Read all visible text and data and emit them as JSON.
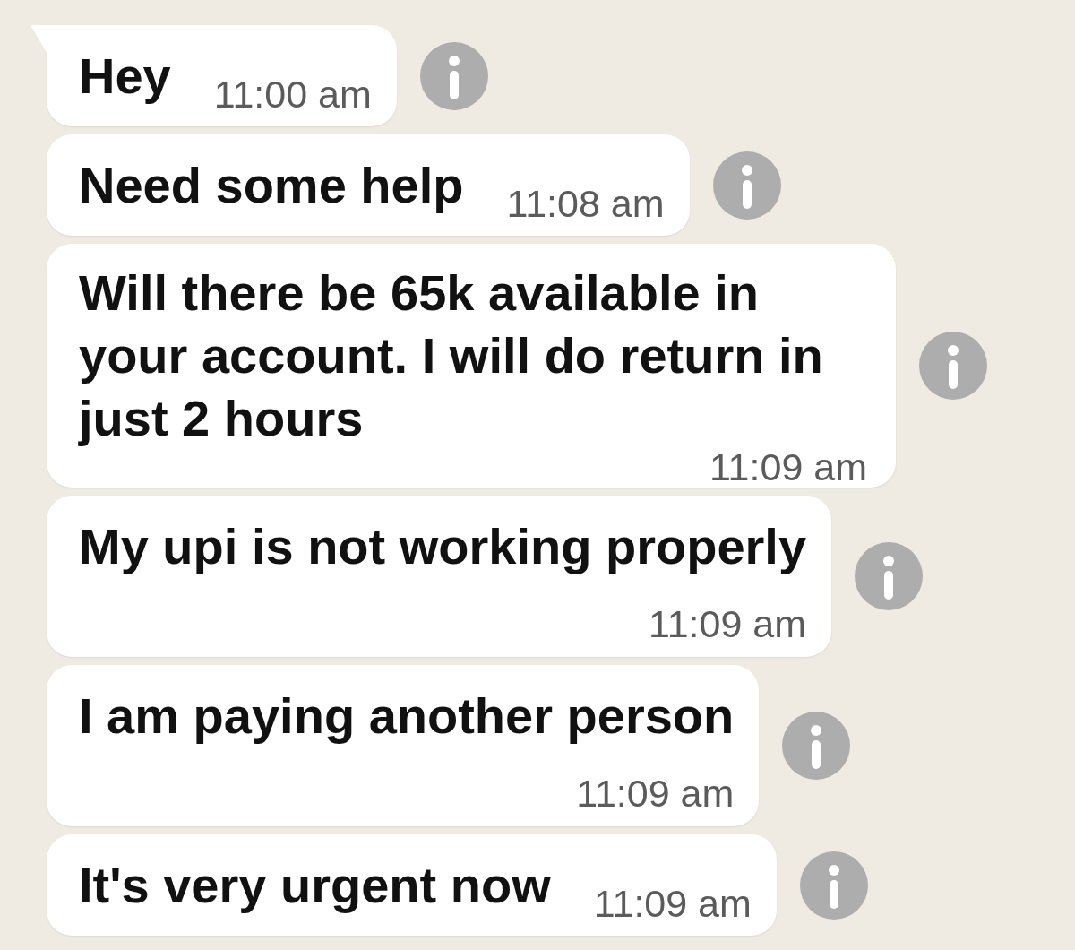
{
  "messages": [
    {
      "text": "Hey",
      "time": "11:00 am",
      "kind": "inline",
      "tail": true
    },
    {
      "text": "Need some help",
      "time": "11:08 am",
      "kind": "inline",
      "tail": false
    },
    {
      "text": "Will there be 65k available in your account. I will do return in just 2 hours",
      "time": "11:09 am",
      "kind": "wrapped",
      "tail": false
    },
    {
      "text": "My upi is not working properly",
      "time": "11:09 am",
      "kind": "stacked",
      "tail": false
    },
    {
      "text": "I am paying another person",
      "time": "11:09 am",
      "kind": "stacked",
      "tail": false
    },
    {
      "text": "It's very urgent now",
      "time": "11:09 am",
      "kind": "inline",
      "tail": false
    }
  ]
}
